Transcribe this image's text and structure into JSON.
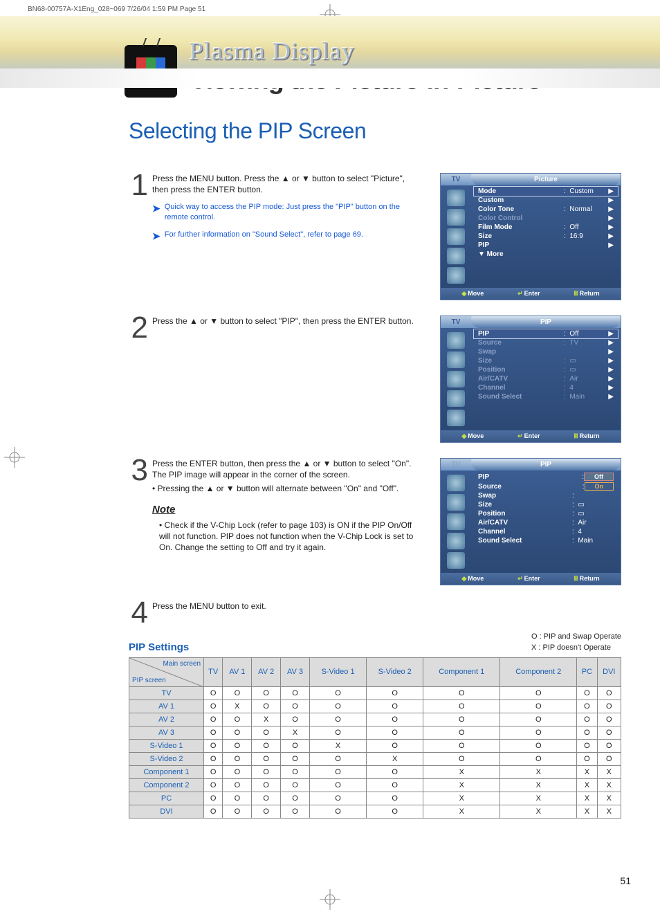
{
  "print_header": "BN68-00757A-X1Eng_028~069  7/26/04  1:59 PM  Page 51",
  "brand_sub": "Plasma Display",
  "brand_title": "Viewing the Picture-in-Picture",
  "section_title": "Selecting the PIP Screen",
  "step1": {
    "num": "1",
    "text": "Press the MENU button. Press the ▲ or ▼ button to select \"Picture\", then press the ENTER button.",
    "tip1": "Quick way to access the PIP mode: Just press the \"PIP\" button on the remote control.",
    "tip2": "For further information on \"Sound Select\", refer to page 69."
  },
  "step2": {
    "num": "2",
    "text": "Press the ▲ or ▼ button to select \"PIP\", then press the ENTER button."
  },
  "step3": {
    "num": "3",
    "text": "Press the ENTER button, then press the ▲ or ▼ button to select \"On\". The PIP image will appear in the corner of the screen.",
    "bullet": "• Pressing the ▲ or ▼ button will alternate between \"On\" and \"Off\".",
    "note_hd": "Note",
    "note_body": "• Check if the V-Chip Lock (refer to page 103) is ON if the PIP On/Off will not function. PIP does not function when the V-Chip Lock is set to On. Change the setting to Off and try it again."
  },
  "step4": {
    "num": "4",
    "text": "Press the MENU button to exit."
  },
  "osd_src": "TV",
  "osd_foot": {
    "move": "Move",
    "enter": "Enter",
    "return": "Return"
  },
  "osd1": {
    "title": "Picture",
    "rows": [
      {
        "label": "Mode",
        "val": "Custom",
        "sel": true
      },
      {
        "label": "Custom",
        "val": ""
      },
      {
        "label": "Color Tone",
        "val": "Normal"
      },
      {
        "label": "Color Control",
        "val": "",
        "dim": true
      },
      {
        "label": "Film Mode",
        "val": "Off"
      },
      {
        "label": "Size",
        "val": "16:9"
      },
      {
        "label": "PIP",
        "val": ""
      },
      {
        "label": "▼ More",
        "val": "",
        "notri": true
      }
    ]
  },
  "osd2": {
    "title": "PIP",
    "rows": [
      {
        "label": "PIP",
        "val": "Off",
        "sel": true
      },
      {
        "label": "Source",
        "val": "TV",
        "dim": true
      },
      {
        "label": "Swap",
        "val": "",
        "dim": true
      },
      {
        "label": "Size",
        "val": "▭",
        "dim": true
      },
      {
        "label": "Position",
        "val": "▭",
        "dim": true
      },
      {
        "label": "Air/CATV",
        "val": "Air",
        "dim": true
      },
      {
        "label": "Channel",
        "val": "4",
        "dim": true
      },
      {
        "label": "Sound Select",
        "val": "Main",
        "dim": true
      }
    ]
  },
  "osd3": {
    "title": "PIP",
    "pip_label": "PIP",
    "pip_off": "Off",
    "pip_on": "On",
    "rows": [
      {
        "label": "Source",
        "val": ""
      },
      {
        "label": "Swap",
        "val": ""
      },
      {
        "label": "Size",
        "val": "▭"
      },
      {
        "label": "Position",
        "val": "▭"
      },
      {
        "label": "Air/CATV",
        "val": "Air"
      },
      {
        "label": "Channel",
        "val": "4"
      },
      {
        "label": "Sound Select",
        "val": "Main"
      }
    ]
  },
  "pip_heading": "PIP Settings",
  "legend_o": "O : PIP and Swap Operate",
  "legend_x": "X : PIP doesn't Operate",
  "table": {
    "corner_main": "Main screen",
    "corner_pip": "PIP screen",
    "cols": [
      "TV",
      "AV 1",
      "AV 2",
      "AV 3",
      "S-Video 1",
      "S-Video 2",
      "Component 1",
      "Component 2",
      "PC",
      "DVI"
    ],
    "rows": [
      {
        "h": "TV",
        "v": [
          "O",
          "O",
          "O",
          "O",
          "O",
          "O",
          "O",
          "O",
          "O",
          "O"
        ]
      },
      {
        "h": "AV 1",
        "v": [
          "O",
          "X",
          "O",
          "O",
          "O",
          "O",
          "O",
          "O",
          "O",
          "O"
        ]
      },
      {
        "h": "AV 2",
        "v": [
          "O",
          "O",
          "X",
          "O",
          "O",
          "O",
          "O",
          "O",
          "O",
          "O"
        ]
      },
      {
        "h": "AV 3",
        "v": [
          "O",
          "O",
          "O",
          "X",
          "O",
          "O",
          "O",
          "O",
          "O",
          "O"
        ]
      },
      {
        "h": "S-Video 1",
        "v": [
          "O",
          "O",
          "O",
          "O",
          "X",
          "O",
          "O",
          "O",
          "O",
          "O"
        ]
      },
      {
        "h": "S-Video 2",
        "v": [
          "O",
          "O",
          "O",
          "O",
          "O",
          "X",
          "O",
          "O",
          "O",
          "O"
        ]
      },
      {
        "h": "Component 1",
        "v": [
          "O",
          "O",
          "O",
          "O",
          "O",
          "O",
          "X",
          "X",
          "X",
          "X"
        ]
      },
      {
        "h": "Component 2",
        "v": [
          "O",
          "O",
          "O",
          "O",
          "O",
          "O",
          "X",
          "X",
          "X",
          "X"
        ]
      },
      {
        "h": "PC",
        "v": [
          "O",
          "O",
          "O",
          "O",
          "O",
          "O",
          "X",
          "X",
          "X",
          "X"
        ]
      },
      {
        "h": "DVI",
        "v": [
          "O",
          "O",
          "O",
          "O",
          "O",
          "O",
          "X",
          "X",
          "X",
          "X"
        ]
      }
    ]
  },
  "page_num": "51"
}
